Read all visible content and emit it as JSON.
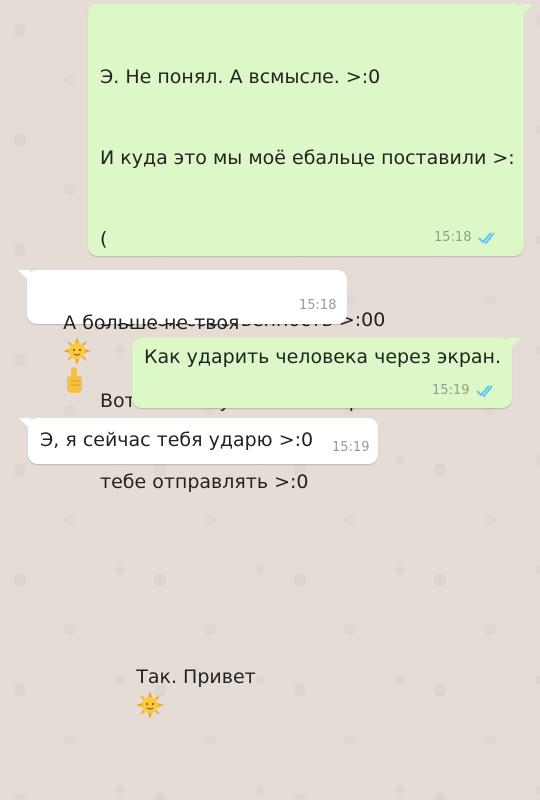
{
  "messages": [
    {
      "lines": [
        "Э. Не понял. А всмысле. >:0",
        "И куда это мы моё ебальце поставили >:",
        "(",
        "Это моя собственность >:00",
        "Вот по этому я и не собирался ничего",
        "тебе отправлять >:0",
        "",
        "Так. Привет"
      ],
      "time": "15:18",
      "direction": "outgoing",
      "emoji": "sun-with-face-icon"
    },
    {
      "text": "А больше не твоя",
      "time": "15:18",
      "direction": "incoming",
      "emoji": [
        "sun-with-face-icon",
        "pointing-up-hand-icon"
      ]
    },
    {
      "text": "Как ударить человека через экран.",
      "time": "15:19",
      "direction": "outgoing"
    },
    {
      "text": "Э, я сейчас тебя ударю >:0",
      "time": "15:19",
      "direction": "incoming"
    }
  ],
  "colors": {
    "outgoing_bubble": "#dcf8c6",
    "incoming_bubble": "#ffffff",
    "background": "#e5ddd5",
    "read_ticks": "#4fc3f7"
  },
  "status": {
    "read_receipt": "double-check-icon"
  }
}
